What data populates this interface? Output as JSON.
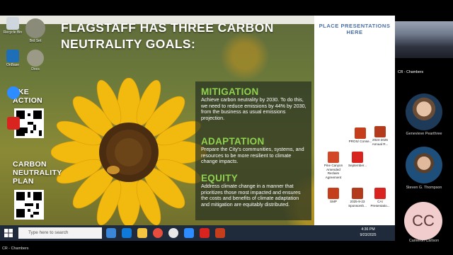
{
  "slide": {
    "title": "FLAGSTAFF HAS THREE CARBON NEUTRALITY GOALS:",
    "goals": [
      {
        "heading": "MITIGATION",
        "text": "Achieve carbon neutrality by 2030. To do this, we need to reduce emissions by 44% by 2030, from the business as usual emissions projection."
      },
      {
        "heading": "ADAPTATION",
        "text": "Prepare the City's communities, systems, and resources to be more resilient to climate change impacts."
      },
      {
        "heading": "EQUITY",
        "text": "Address climate change in a manner that prioritizes those most impacted and ensures the costs and benefits of climate adaptation and mitigation are equitably distributed."
      }
    ],
    "take_action": "TAKE ACTION",
    "take_action_visible": "AKE\nACTION",
    "carbon_plan": "CARBON NEUTRALITY PLAN"
  },
  "desktop_icons": [
    {
      "label": "Recycle Bin",
      "icon": "recycle-bin-icon"
    },
    {
      "label": "Brd Set",
      "icon": "seal-icon"
    },
    {
      "label": "OnBase",
      "icon": "onbase-icon"
    },
    {
      "label": "Docs",
      "icon": "seal-icon"
    },
    {
      "label": "Zoom",
      "icon": "zoom-icon"
    },
    {
      "label": "Acrobat",
      "icon": "pdf-icon"
    }
  ],
  "place_area": {
    "text": "PLACE PRESENTATIONS HERE"
  },
  "files": [
    {
      "label": "PROS/ Conse...",
      "icon": "ppt-icon",
      "color": "#c43e1c"
    },
    {
      "label": "2024-2025 Annual R...",
      "icon": "ppt-icon",
      "color": "#b33a1a"
    },
    {
      "label": "Pine Canyon Amended Reclaim Agreement",
      "icon": "ppt-icon",
      "color": "#d24726"
    },
    {
      "label": "September...",
      "icon": "pdf-icon",
      "color": "#d9231e"
    },
    {
      "label": "SMP",
      "icon": "ppt-icon",
      "color": "#c43e1c"
    },
    {
      "label": "2025-9-23 Sponsorsh...",
      "icon": "ppt-icon",
      "color": "#b33a1a"
    },
    {
      "label": "CAI Presentatio...",
      "icon": "pdf-icon",
      "color": "#d9231e"
    }
  ],
  "taskbar": {
    "search_placeholder": "Type here to search",
    "time": "4:36 PM",
    "date": "9/23/2025"
  },
  "participants": {
    "room_label": "CR - Chambers",
    "people": [
      {
        "name": "Genevieve Pearthree"
      },
      {
        "name": "Steven G. Thompson"
      },
      {
        "name": "Cameron Carlson",
        "initials": "CC"
      }
    ],
    "bottom_label": "CR - Chambers"
  },
  "colors": {
    "goal_heading": "#8fd14f",
    "place_text": "#4a6fa8",
    "cc_avatar": "#f2cdcd"
  }
}
